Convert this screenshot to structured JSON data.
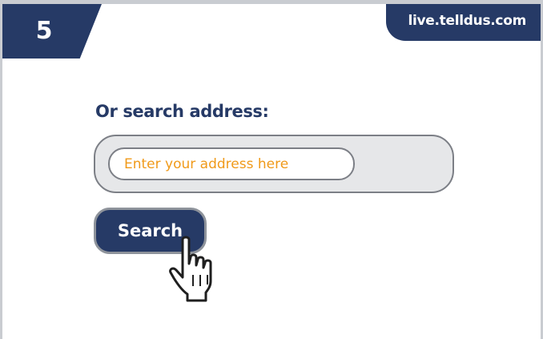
{
  "step": {
    "number": "5"
  },
  "site": {
    "url": "live.telldus.com"
  },
  "search": {
    "heading": "Or search address:",
    "placeholder": "Enter your address here",
    "button_label": "Search"
  },
  "cursor": {
    "icon": "hand-pointer-icon"
  },
  "colors": {
    "brand_navy": "#263a66",
    "placeholder_orange": "#f09a1a",
    "panel_gray": "#e6e7e9",
    "border_gray": "#7c7f86"
  }
}
